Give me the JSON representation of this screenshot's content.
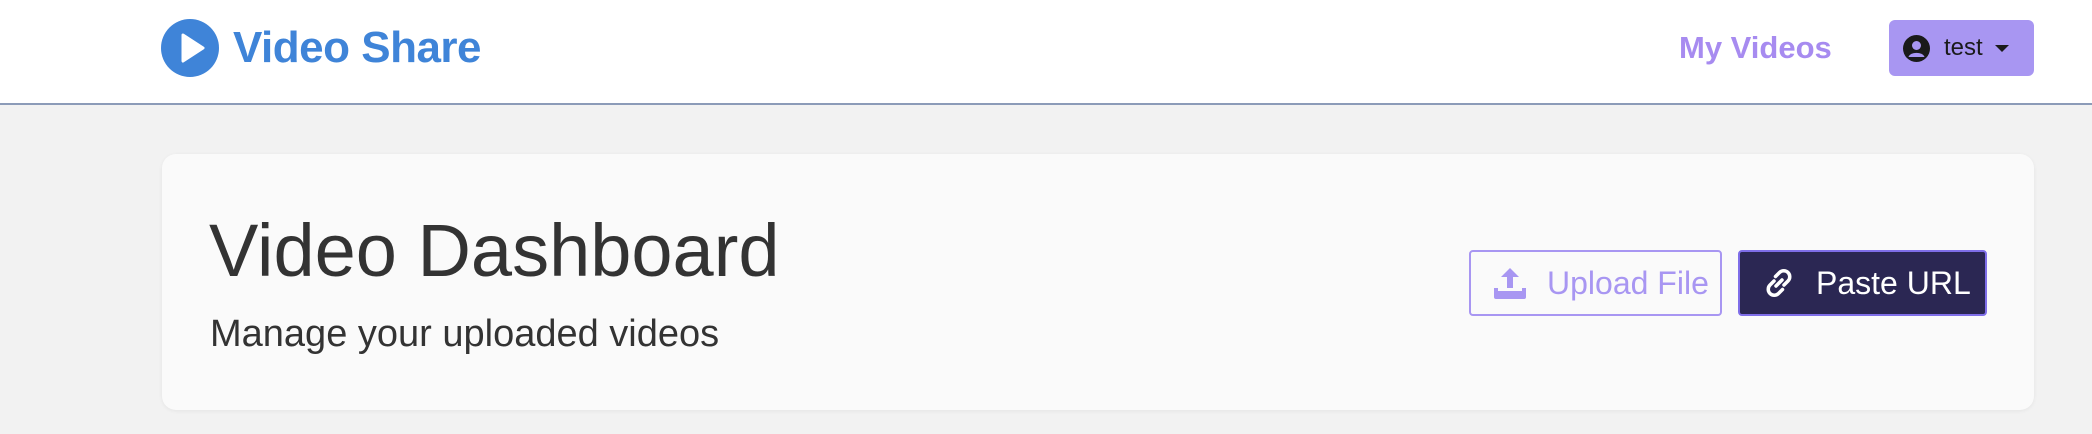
{
  "navbar": {
    "brand": {
      "text": "Video Share",
      "icon": "play-circle-icon",
      "color": "#3f84d8"
    },
    "links": [
      {
        "label": "My Videos"
      }
    ],
    "user_menu": {
      "icon": "user-circle-icon",
      "name": "test",
      "caret": "chevron-down-icon"
    }
  },
  "dashboard": {
    "title": "Video Dashboard",
    "subtitle": "Manage your uploaded videos",
    "actions": {
      "upload": {
        "label": "Upload File",
        "icon": "upload-icon"
      },
      "paste": {
        "label": "Paste URL",
        "icon": "link-icon"
      }
    }
  },
  "colors": {
    "accent": "#a896f2",
    "dark_button": "#2b2753",
    "page_background": "#f2f2f2"
  }
}
